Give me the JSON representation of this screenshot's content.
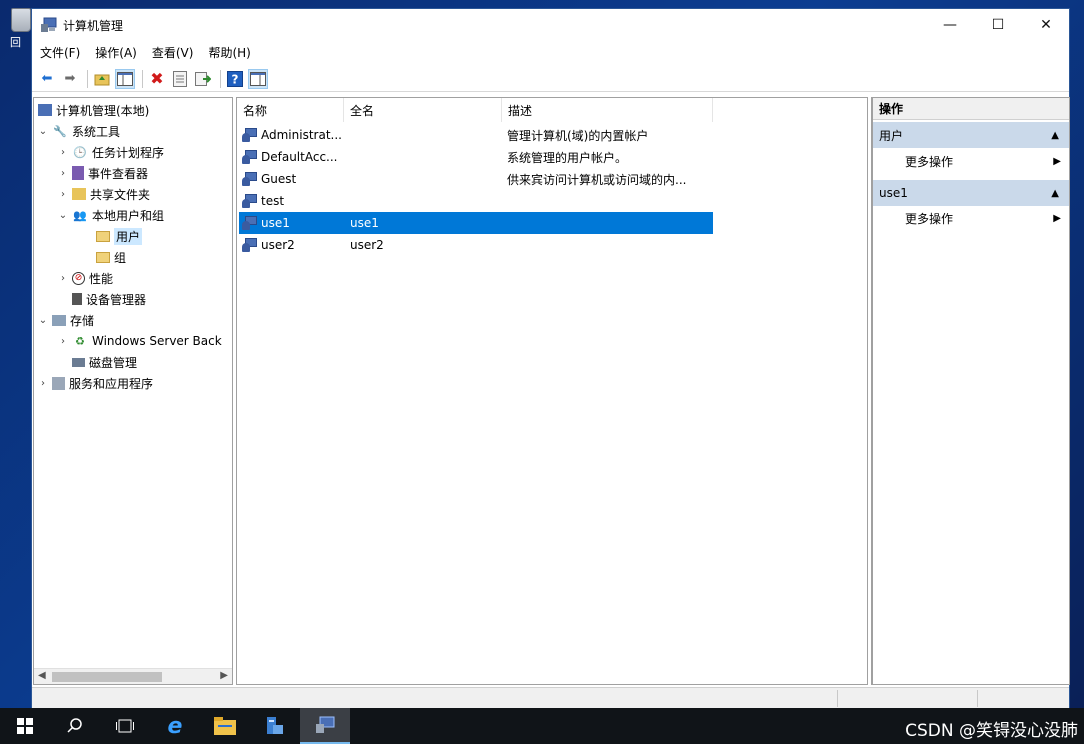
{
  "desktop": {
    "recycle_label": "回"
  },
  "window": {
    "title": "计算机管理",
    "controls": {
      "minimize": "—",
      "maximize": "☐",
      "close": "✕"
    }
  },
  "menu": [
    "文件(F)",
    "操作(A)",
    "查看(V)",
    "帮助(H)"
  ],
  "tree": {
    "root": "计算机管理(本地)",
    "system_tools": "系统工具",
    "task_scheduler": "任务计划程序",
    "event_viewer": "事件查看器",
    "shared_folders": "共享文件夹",
    "local_users_groups": "本地用户和组",
    "users": "用户",
    "groups": "组",
    "performance": "性能",
    "device_manager": "设备管理器",
    "storage": "存储",
    "windows_backup": "Windows Server Back",
    "disk_management": "磁盘管理",
    "services_apps": "服务和应用程序"
  },
  "list": {
    "columns": [
      "名称",
      "全名",
      "描述"
    ],
    "rows": [
      {
        "name": "Administrat...",
        "fullname": "",
        "desc": "管理计算机(域)的内置帐户"
      },
      {
        "name": "DefaultAcc...",
        "fullname": "",
        "desc": "系统管理的用户帐户。"
      },
      {
        "name": "Guest",
        "fullname": "",
        "desc": "供来宾访问计算机或访问域的内..."
      },
      {
        "name": "test",
        "fullname": "",
        "desc": ""
      },
      {
        "name": "use1",
        "fullname": "use1",
        "desc": ""
      },
      {
        "name": "user2",
        "fullname": "user2",
        "desc": ""
      }
    ],
    "selected_index": 4
  },
  "actions": {
    "header": "操作",
    "section1": "用户",
    "section1_item": "更多操作",
    "section2": "use1",
    "section2_item": "更多操作"
  },
  "watermark": "CSDN @笑锝没心没肺",
  "colors": {
    "selection": "#0078d7",
    "action_section": "#cad9ea",
    "desktop": "#0b3d91"
  }
}
